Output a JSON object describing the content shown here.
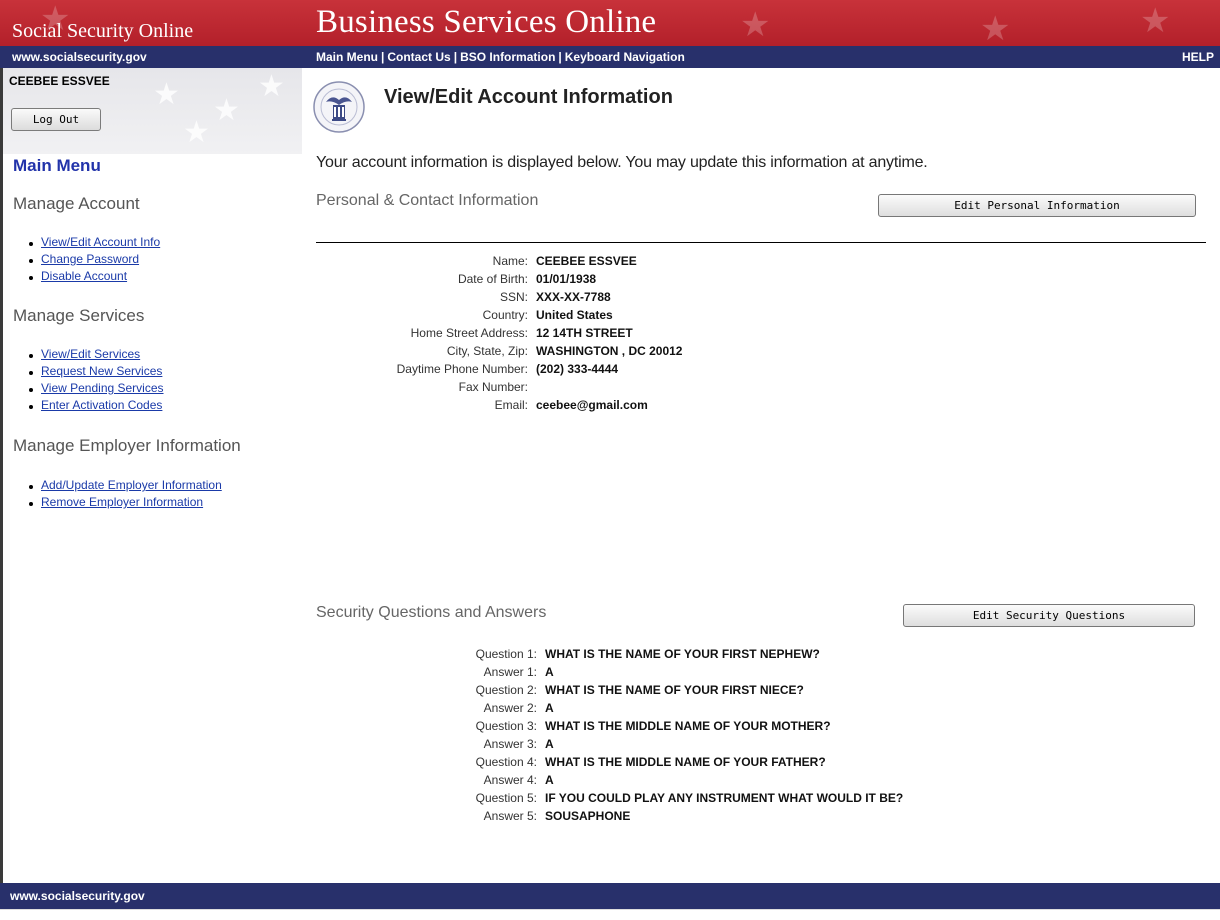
{
  "header": {
    "site_title": "Social Security Online",
    "app_title": "Business Services Online",
    "url": "www.socialsecurity.gov",
    "nav": [
      "Main Menu",
      "Contact Us",
      "BSO Information",
      "Keyboard Navigation"
    ],
    "help": "HELP"
  },
  "sidebar": {
    "user_name": "CEEBEE ESSVEE",
    "logout_label": "Log Out",
    "main_menu": "Main Menu",
    "sections": [
      {
        "title": "Manage Account",
        "links": [
          "View/Edit Account Info",
          "Change Password",
          "Disable Account"
        ]
      },
      {
        "title": "Manage Services",
        "links": [
          "View/Edit Services",
          "Request New Services",
          "View Pending Services",
          "Enter Activation Codes"
        ]
      },
      {
        "title": "Manage Employer Information",
        "links": [
          "Add/Update Employer Information",
          "Remove Employer Information"
        ]
      }
    ]
  },
  "main": {
    "title": "View/Edit Account Information",
    "intro": "Your account information is displayed below. You may update this information at anytime.",
    "personal": {
      "heading": "Personal & Contact Information",
      "edit_label": "Edit Personal Information",
      "fields": [
        {
          "label": "Name:",
          "value": "CEEBEE ESSVEE"
        },
        {
          "label": "Date of Birth:",
          "value": "01/01/1938"
        },
        {
          "label": "SSN:",
          "value": "XXX-XX-7788"
        },
        {
          "label": "Country:",
          "value": "United States"
        },
        {
          "label": "Home Street Address:",
          "value": "12 14TH STREET"
        },
        {
          "label": "City, State, Zip:",
          "value": "WASHINGTON , DC 20012"
        },
        {
          "label": "Daytime Phone Number:",
          "value": "(202) 333-4444"
        },
        {
          "label": "Fax Number:",
          "value": ""
        },
        {
          "label": "Email:",
          "value": "ceebee@gmail.com"
        }
      ]
    },
    "security": {
      "heading": "Security Questions and Answers",
      "edit_label": "Edit Security Questions",
      "fields": [
        {
          "label": "Question 1:",
          "value": "WHAT IS THE NAME OF YOUR FIRST NEPHEW?"
        },
        {
          "label": "Answer 1:",
          "value": "A"
        },
        {
          "label": "Question 2:",
          "value": "WHAT IS THE NAME OF YOUR FIRST NIECE?"
        },
        {
          "label": "Answer 2:",
          "value": "A"
        },
        {
          "label": "Question 3:",
          "value": "WHAT IS THE MIDDLE NAME OF YOUR MOTHER?"
        },
        {
          "label": "Answer 3:",
          "value": "A"
        },
        {
          "label": "Question 4:",
          "value": "WHAT IS THE MIDDLE NAME OF YOUR FATHER?"
        },
        {
          "label": "Answer 4:",
          "value": "A"
        },
        {
          "label": "Question 5:",
          "value": "IF YOU COULD PLAY ANY INSTRUMENT WHAT WOULD IT BE?"
        },
        {
          "label": "Answer 5:",
          "value": "SOUSAPHONE"
        }
      ]
    }
  },
  "footer": {
    "url": "www.socialsecurity.gov"
  },
  "colors": {
    "header_red": "#b3202a",
    "header_navy": "#28306b",
    "link_blue": "#1a3aa8",
    "main_menu_blue": "#2233aa"
  }
}
